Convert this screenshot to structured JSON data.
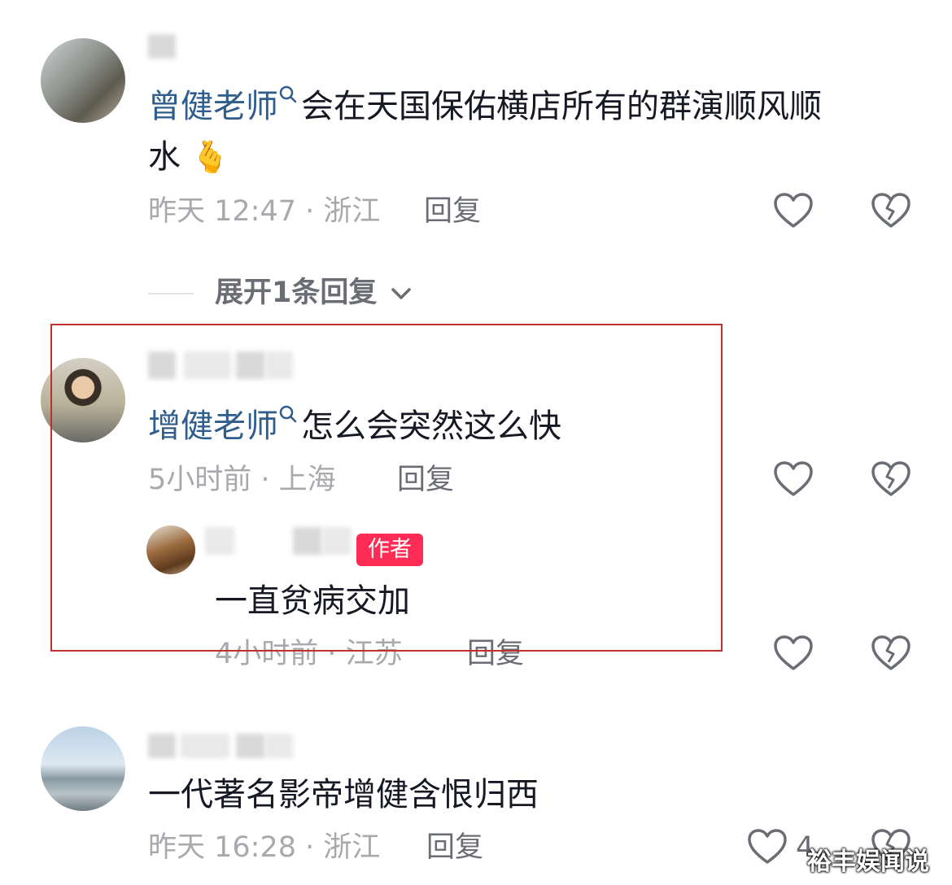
{
  "comments": [
    {
      "mention": "曾健老师",
      "text": "会在天国保佑横店所有的群演顺风顺",
      "text_line2": "水",
      "emoji": "🫰",
      "time": "昨天 12:47 · 浙江",
      "reply": "回复"
    },
    {
      "mention": "增健老师",
      "text": "怎么会突然这么快",
      "time": "5小时前 · 上海",
      "reply": "回复"
    },
    {
      "mention": "",
      "text": "一代著名影帝增健含恨归西",
      "time": "昨天 16:28 · 浙江",
      "reply": "回复",
      "like_count": "4"
    }
  ],
  "expand_replies": "展开1条回复",
  "nested_reply": {
    "badge": "作者",
    "text": "一直贫病交加",
    "time": "4小时前 · 江苏",
    "reply": "回复"
  },
  "watermark": "裕丰娱闻说",
  "colors": {
    "mention": "#2f5d8c",
    "author_badge": "#fe2c55",
    "highlight_box": "#c0302d",
    "meta_text": "#a8a9ad"
  },
  "icons": [
    "heart-outline-icon",
    "broken-heart-icon",
    "search-icon",
    "chevron-down-icon"
  ]
}
